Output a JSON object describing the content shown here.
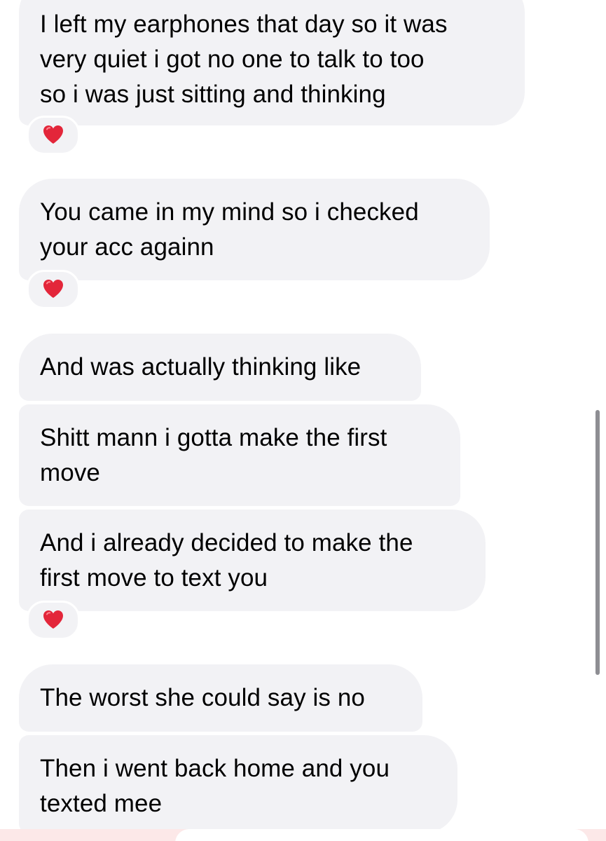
{
  "messages": [
    {
      "text": "I left my earphones that day so it was\nvery quiet i got no one to talk to too\nso i was just sitting and thinking",
      "reaction": "❤️"
    },
    {
      "text": "You came in my mind so i checked\nyour acc againn",
      "reaction": "❤️"
    },
    {
      "text": "And was actually thinking like",
      "reaction": ""
    },
    {
      "text": "Shitt mann i gotta make the first\nmove",
      "reaction": ""
    },
    {
      "text": "And i already decided to make the\nfirst move to text you",
      "reaction": "❤️"
    },
    {
      "text": "The worst she could say is no",
      "reaction": ""
    },
    {
      "text": "Then i went back home and you\ntexted mee",
      "reaction": ""
    }
  ],
  "colors": {
    "bubble": "#f2f2f5",
    "heart": "#e3263a",
    "scrollbar": "#8e8e93"
  },
  "icons": {
    "reaction": "red-heart-icon"
  }
}
